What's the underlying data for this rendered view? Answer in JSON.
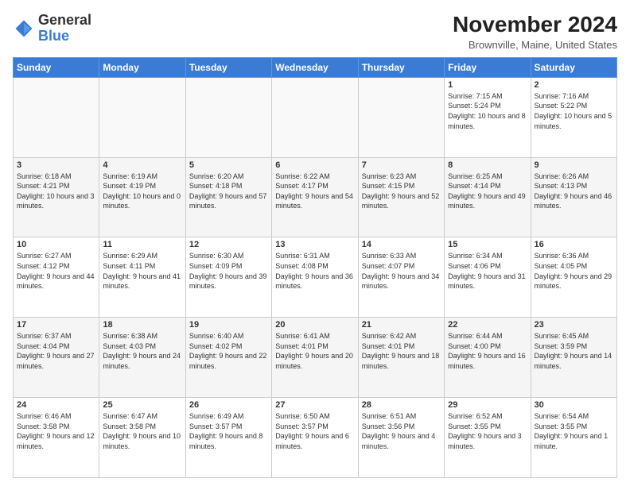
{
  "logo": {
    "general": "General",
    "blue": "Blue"
  },
  "header": {
    "month": "November 2024",
    "location": "Brownville, Maine, United States"
  },
  "weekdays": [
    "Sunday",
    "Monday",
    "Tuesday",
    "Wednesday",
    "Thursday",
    "Friday",
    "Saturday"
  ],
  "weeks": [
    [
      {
        "day": "",
        "info": ""
      },
      {
        "day": "",
        "info": ""
      },
      {
        "day": "",
        "info": ""
      },
      {
        "day": "",
        "info": ""
      },
      {
        "day": "",
        "info": ""
      },
      {
        "day": "1",
        "info": "Sunrise: 7:15 AM\nSunset: 5:24 PM\nDaylight: 10 hours\nand 8 minutes."
      },
      {
        "day": "2",
        "info": "Sunrise: 7:16 AM\nSunset: 5:22 PM\nDaylight: 10 hours\nand 5 minutes."
      }
    ],
    [
      {
        "day": "3",
        "info": "Sunrise: 6:18 AM\nSunset: 4:21 PM\nDaylight: 10 hours\nand 3 minutes."
      },
      {
        "day": "4",
        "info": "Sunrise: 6:19 AM\nSunset: 4:19 PM\nDaylight: 10 hours\nand 0 minutes."
      },
      {
        "day": "5",
        "info": "Sunrise: 6:20 AM\nSunset: 4:18 PM\nDaylight: 9 hours\nand 57 minutes."
      },
      {
        "day": "6",
        "info": "Sunrise: 6:22 AM\nSunset: 4:17 PM\nDaylight: 9 hours\nand 54 minutes."
      },
      {
        "day": "7",
        "info": "Sunrise: 6:23 AM\nSunset: 4:15 PM\nDaylight: 9 hours\nand 52 minutes."
      },
      {
        "day": "8",
        "info": "Sunrise: 6:25 AM\nSunset: 4:14 PM\nDaylight: 9 hours\nand 49 minutes."
      },
      {
        "day": "9",
        "info": "Sunrise: 6:26 AM\nSunset: 4:13 PM\nDaylight: 9 hours\nand 46 minutes."
      }
    ],
    [
      {
        "day": "10",
        "info": "Sunrise: 6:27 AM\nSunset: 4:12 PM\nDaylight: 9 hours\nand 44 minutes."
      },
      {
        "day": "11",
        "info": "Sunrise: 6:29 AM\nSunset: 4:11 PM\nDaylight: 9 hours\nand 41 minutes."
      },
      {
        "day": "12",
        "info": "Sunrise: 6:30 AM\nSunset: 4:09 PM\nDaylight: 9 hours\nand 39 minutes."
      },
      {
        "day": "13",
        "info": "Sunrise: 6:31 AM\nSunset: 4:08 PM\nDaylight: 9 hours\nand 36 minutes."
      },
      {
        "day": "14",
        "info": "Sunrise: 6:33 AM\nSunset: 4:07 PM\nDaylight: 9 hours\nand 34 minutes."
      },
      {
        "day": "15",
        "info": "Sunrise: 6:34 AM\nSunset: 4:06 PM\nDaylight: 9 hours\nand 31 minutes."
      },
      {
        "day": "16",
        "info": "Sunrise: 6:36 AM\nSunset: 4:05 PM\nDaylight: 9 hours\nand 29 minutes."
      }
    ],
    [
      {
        "day": "17",
        "info": "Sunrise: 6:37 AM\nSunset: 4:04 PM\nDaylight: 9 hours\nand 27 minutes."
      },
      {
        "day": "18",
        "info": "Sunrise: 6:38 AM\nSunset: 4:03 PM\nDaylight: 9 hours\nand 24 minutes."
      },
      {
        "day": "19",
        "info": "Sunrise: 6:40 AM\nSunset: 4:02 PM\nDaylight: 9 hours\nand 22 minutes."
      },
      {
        "day": "20",
        "info": "Sunrise: 6:41 AM\nSunset: 4:01 PM\nDaylight: 9 hours\nand 20 minutes."
      },
      {
        "day": "21",
        "info": "Sunrise: 6:42 AM\nSunset: 4:01 PM\nDaylight: 9 hours\nand 18 minutes."
      },
      {
        "day": "22",
        "info": "Sunrise: 6:44 AM\nSunset: 4:00 PM\nDaylight: 9 hours\nand 16 minutes."
      },
      {
        "day": "23",
        "info": "Sunrise: 6:45 AM\nSunset: 3:59 PM\nDaylight: 9 hours\nand 14 minutes."
      }
    ],
    [
      {
        "day": "24",
        "info": "Sunrise: 6:46 AM\nSunset: 3:58 PM\nDaylight: 9 hours\nand 12 minutes."
      },
      {
        "day": "25",
        "info": "Sunrise: 6:47 AM\nSunset: 3:58 PM\nDaylight: 9 hours\nand 10 minutes."
      },
      {
        "day": "26",
        "info": "Sunrise: 6:49 AM\nSunset: 3:57 PM\nDaylight: 9 hours\nand 8 minutes."
      },
      {
        "day": "27",
        "info": "Sunrise: 6:50 AM\nSunset: 3:57 PM\nDaylight: 9 hours\nand 6 minutes."
      },
      {
        "day": "28",
        "info": "Sunrise: 6:51 AM\nSunset: 3:56 PM\nDaylight: 9 hours\nand 4 minutes."
      },
      {
        "day": "29",
        "info": "Sunrise: 6:52 AM\nSunset: 3:55 PM\nDaylight: 9 hours\nand 3 minutes."
      },
      {
        "day": "30",
        "info": "Sunrise: 6:54 AM\nSunset: 3:55 PM\nDaylight: 9 hours\nand 1 minute."
      }
    ]
  ]
}
